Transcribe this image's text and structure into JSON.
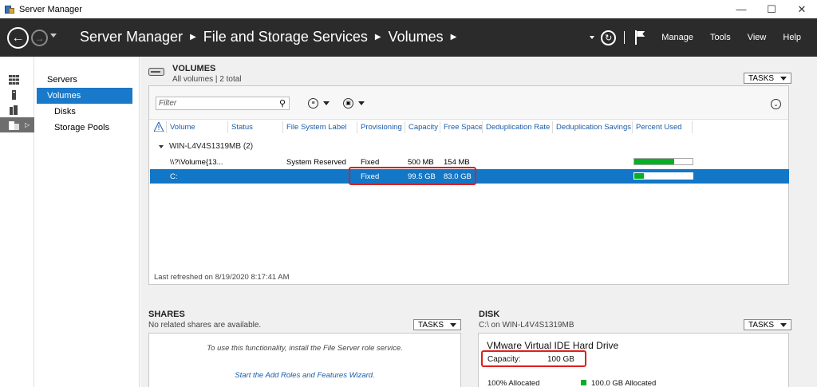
{
  "window": {
    "title": "Server Manager",
    "controls": {
      "minimize": "—",
      "maximize": "☐",
      "close": "✕"
    }
  },
  "header": {
    "breadcrumb": [
      "Server Manager",
      "File and Storage Services",
      "Volumes"
    ],
    "menu": [
      "Manage",
      "Tools",
      "View",
      "Help"
    ],
    "icons": [
      "back-icon",
      "forward-icon",
      "refresh-icon",
      "flag-icon"
    ]
  },
  "rail": {
    "items": [
      "dashboard-icon",
      "local-server-icon",
      "all-servers-icon",
      "file-storage-icon"
    ],
    "selected_index": 3
  },
  "nav": {
    "items": [
      {
        "label": "Servers",
        "level": 0,
        "selected": false
      },
      {
        "label": "Volumes",
        "level": 0,
        "selected": true
      },
      {
        "label": "Disks",
        "level": 1,
        "selected": false
      },
      {
        "label": "Storage Pools",
        "level": 1,
        "selected": false
      }
    ]
  },
  "volumes": {
    "title": "VOLUMES",
    "subtitle": "All volumes | 2 total",
    "tasks_label": "TASKS",
    "filter_placeholder": "Filter",
    "columns": [
      "Volume",
      "Status",
      "File System Label",
      "Provisioning",
      "Capacity",
      "Free Space",
      "Deduplication Rate",
      "Deduplication Savings",
      "Percent Used"
    ],
    "group": "WIN-L4V4S1319MB (2)",
    "rows": [
      {
        "volume": "\\\\?\\Volume{13...",
        "status": "",
        "label": "System Reserved",
        "provisioning": "Fixed",
        "capacity": "500 MB",
        "free": "154 MB",
        "percent_used": 69,
        "selected": false
      },
      {
        "volume": "C:",
        "status": "",
        "label": "",
        "provisioning": "Fixed",
        "capacity": "99.5 GB",
        "free": "83.0 GB",
        "percent_used": 17,
        "selected": true
      }
    ],
    "last_refreshed": "Last refreshed on 8/19/2020 8:17:41 AM"
  },
  "shares": {
    "title": "SHARES",
    "subtitle": "No related shares are available.",
    "tasks_label": "TASKS",
    "message": "To use this functionality, install the File Server role service.",
    "link": "Start the Add Roles and Features Wizard."
  },
  "disk": {
    "title": "DISK",
    "subtitle": "C:\\ on WIN-L4V4S1319MB",
    "tasks_label": "TASKS",
    "name": "VMware Virtual IDE Hard Drive",
    "capacity_label": "Capacity:",
    "capacity_value": "100 GB",
    "allocated_label": "100% Allocated",
    "allocated_value": "100.0 GB Allocated"
  },
  "colors": {
    "header_bg": "#2b2b2b",
    "selection": "#1277c7",
    "nav_selection": "#1979ca",
    "bar_fill": "#06b025",
    "highlight": "#e01e1e"
  }
}
